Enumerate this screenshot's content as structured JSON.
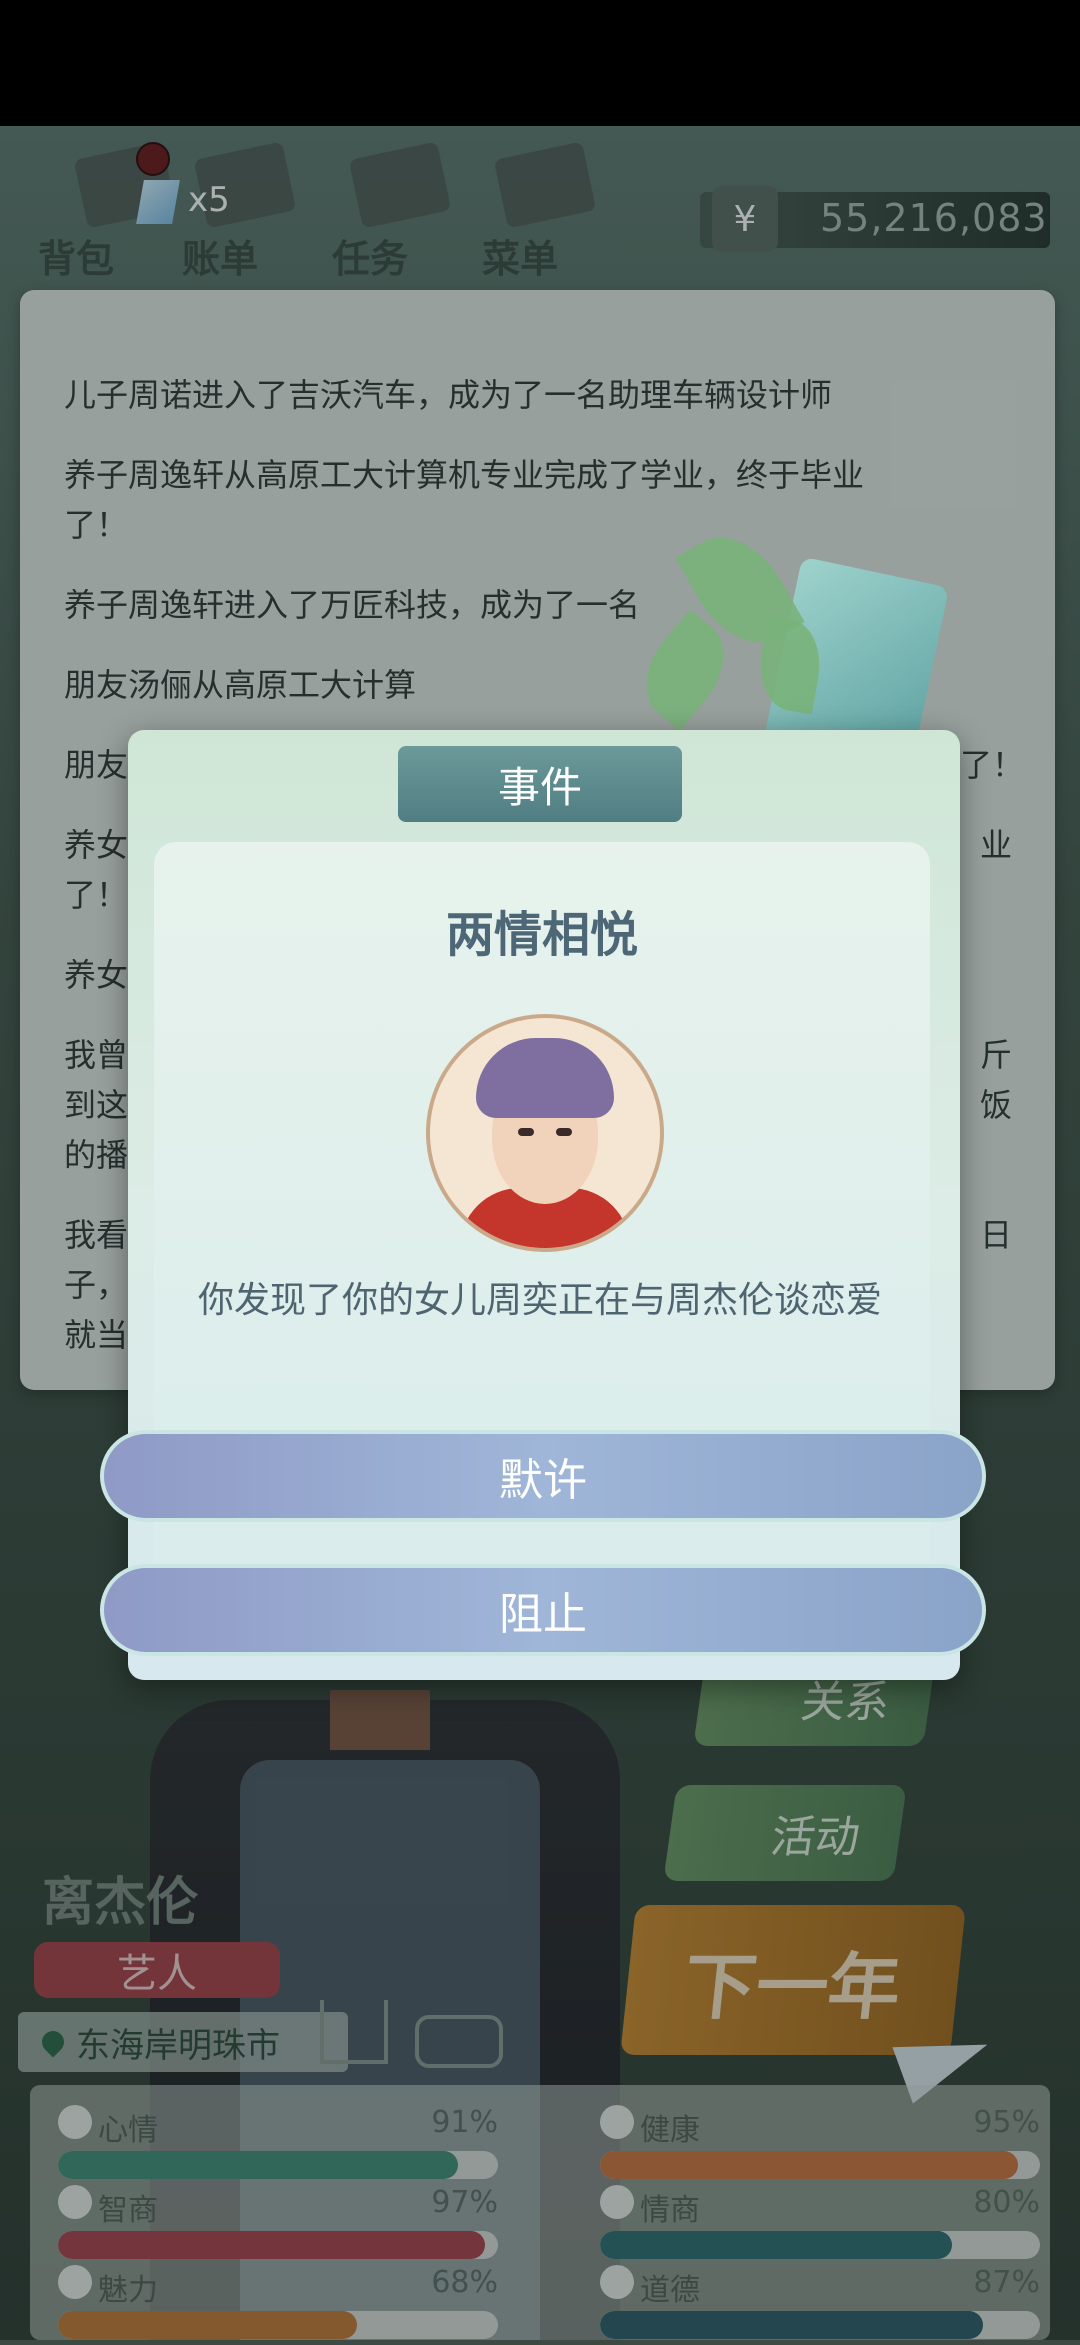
{
  "topbar": {
    "gem_count": "x5",
    "nav": [
      "背包",
      "账单",
      "任务",
      "菜单"
    ],
    "currency_symbol": "¥",
    "money": "55,216,083"
  },
  "log": {
    "lines": [
      "儿子周诺进入了吉沃汽车，成为了一名助理车辆设计师",
      "养子周逸轩从高原工大计算机专业完成了学业，终于毕业",
      "了！",
      "养子周逸轩进入了万匠科技，成为了一名",
      "朋友汤俪从高原工大计算",
      "朋友汤",
      "养女",
      "了！",
      "养女",
      "我曾",
      "到这",
      "的播",
      "我看",
      "子，",
      "就当"
    ],
    "right_fragments": [
      "了！",
      "业",
      "斤",
      "饭",
      "日"
    ]
  },
  "dialog": {
    "tab_label": "事件",
    "title": "两情相悦",
    "description": "你发现了你的女儿周奕正在与周杰伦谈恋爱",
    "choices": [
      "默许",
      "阻止"
    ]
  },
  "side_buttons": [
    "关系",
    "活动"
  ],
  "next_year": "下一年",
  "character": {
    "name": "离杰伦",
    "job": "艺人",
    "location": "东海岸明珠市"
  },
  "stats": [
    {
      "label": "心情",
      "value": "91%",
      "fraction": 0.91,
      "color": "#3f8f78"
    },
    {
      "label": "健康",
      "value": "95%",
      "fraction": 0.95,
      "color": "#c9763f"
    },
    {
      "label": "智商",
      "value": "97%",
      "fraction": 0.97,
      "color": "#a9424e"
    },
    {
      "label": "情商",
      "value": "80%",
      "fraction": 0.8,
      "color": "#2b6d72"
    },
    {
      "label": "魅力",
      "value": "68%",
      "fraction": 0.68,
      "color": "#c17a36"
    },
    {
      "label": "道德",
      "value": "87%",
      "fraction": 0.87,
      "color": "#2d5d6a"
    }
  ]
}
